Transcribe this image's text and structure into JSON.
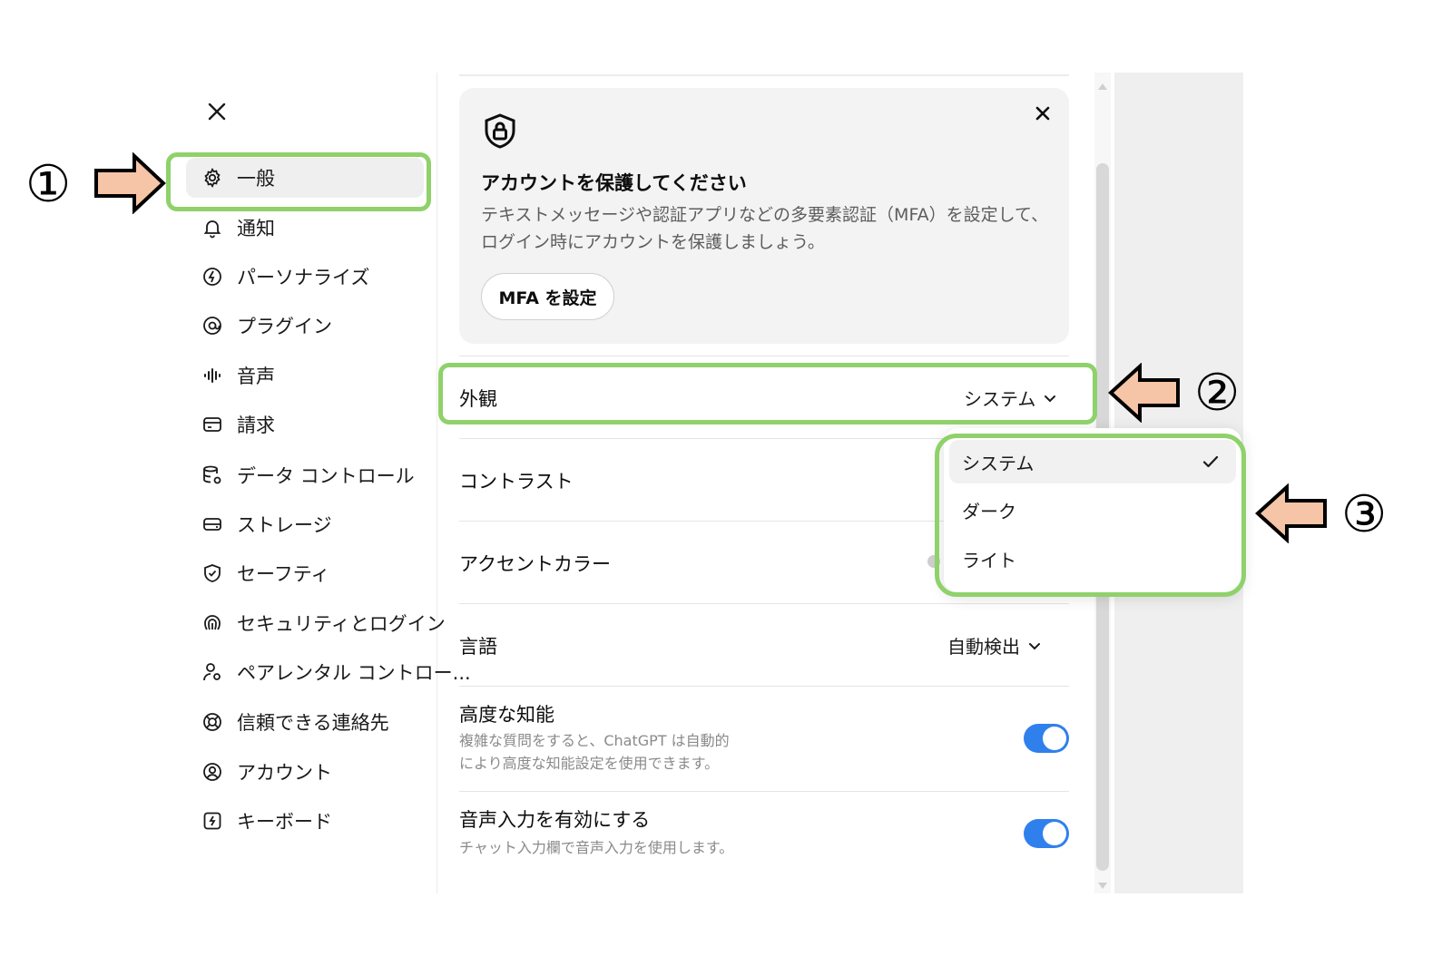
{
  "sidebar": {
    "items": [
      {
        "label": "一般",
        "icon": "gear-icon"
      },
      {
        "label": "通知",
        "icon": "bell-icon"
      },
      {
        "label": "パーソナライズ",
        "icon": "personalize-icon"
      },
      {
        "label": "プラグイン",
        "icon": "plugin-icon"
      },
      {
        "label": "音声",
        "icon": "audio-wave-icon"
      },
      {
        "label": "請求",
        "icon": "card-icon"
      },
      {
        "label": "データ コントロール",
        "icon": "database-gear-icon"
      },
      {
        "label": "ストレージ",
        "icon": "drive-icon"
      },
      {
        "label": "セーフティ",
        "icon": "shield-check-icon"
      },
      {
        "label": "セキュリティとログイン",
        "icon": "fingerprint-icon"
      },
      {
        "label": "ペアレンタル コントロー...",
        "icon": "parent-user-icon"
      },
      {
        "label": "信頼できる連絡先",
        "icon": "lifebuoy-icon"
      },
      {
        "label": "アカウント",
        "icon": "account-icon"
      },
      {
        "label": "キーボード",
        "icon": "keyboard-icon"
      }
    ]
  },
  "mfa_card": {
    "title": "アカウントを保護してください",
    "description": "テキストメッセージや認証アプリなどの多要素認証（MFA）を設定して、ログイン時にアカウントを保護しましょう。",
    "button_label": "MFA を設定"
  },
  "settings": {
    "appearance": {
      "label": "外観",
      "value": "システム"
    },
    "contrast": {
      "label": "コントラスト"
    },
    "accent": {
      "label": "アクセントカラー"
    },
    "language": {
      "label": "言語",
      "value": "自動検出"
    },
    "advanced": {
      "label": "高度な知能",
      "description_line1": "複雑な質問をすると、ChatGPT は自動的",
      "description_line2": "により高度な知能設定を使用できます。",
      "enabled": true
    },
    "voice_input": {
      "label": "音声入力を有効にする",
      "description": "チャット入力欄で音声入力を使用します。",
      "enabled": true
    }
  },
  "dropdown": {
    "options": [
      "システム",
      "ダーク",
      "ライト"
    ],
    "selected": "システム"
  },
  "annotations": {
    "marker1": "①",
    "marker2": "②",
    "marker3": "③"
  },
  "colors": {
    "highlight": "#8fd16a",
    "arrow_fill": "#f6c4a6",
    "toggle_on": "#2f80ed"
  }
}
